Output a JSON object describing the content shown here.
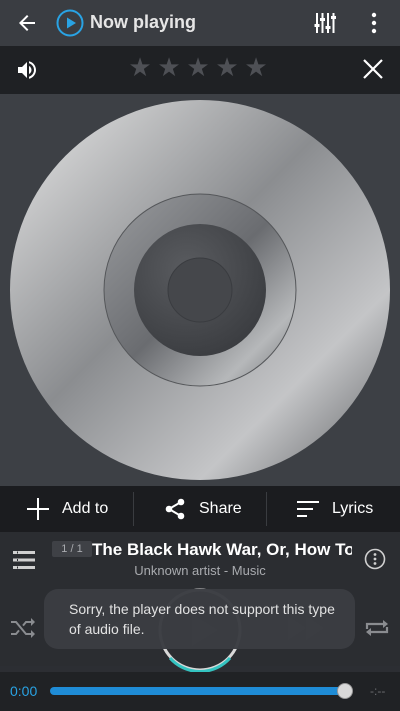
{
  "header": {
    "title": "Now playing",
    "back_icon": "arrow-left-icon",
    "logo_icon": "play-circle-logo-icon",
    "equalizer_icon": "equalizer-icon",
    "more_icon": "more-vertical-icon"
  },
  "rating_bar": {
    "volume_icon": "volume-icon",
    "stars": 0,
    "star_count": 5,
    "close_icon": "close-icon"
  },
  "actions": {
    "add_label": "Add to",
    "share_label": "Share",
    "lyrics_label": "Lyrics"
  },
  "track": {
    "counter": "1 / 1",
    "title": "The Black Hawk War, Or, How To",
    "subtitle": "Unknown artist - Music"
  },
  "toast": {
    "message": "Sorry, the player does not support this type of audio file."
  },
  "progress": {
    "current": "0:00",
    "end": "-:--",
    "fraction": 0.98
  },
  "colors": {
    "accent": "#29a3e4",
    "topbar": "#3a3d42",
    "background": "#2c2e33"
  }
}
